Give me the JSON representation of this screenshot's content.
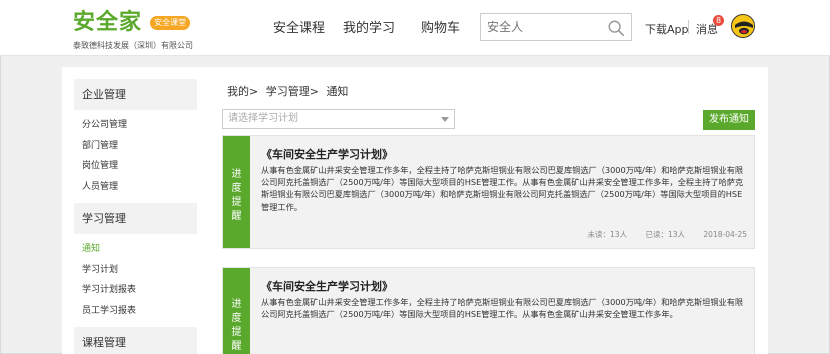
{
  "header": {
    "logo_main": "安全家",
    "logo_badge": "安全课堂",
    "logo_sub": "泰致德科技发展（深圳）有限公司",
    "nav": [
      {
        "label": "安全课程"
      },
      {
        "label": "我的学习"
      },
      {
        "label": "购物车"
      }
    ],
    "search_placeholder": "安全人",
    "download_label": "下载App",
    "message_label": "消息",
    "message_count": "8"
  },
  "sidebar": {
    "groups": [
      {
        "title": "企业管理",
        "items": [
          "分公司管理",
          "部门管理",
          "岗位管理",
          "人员管理"
        ]
      },
      {
        "title": "学习管理",
        "items": [
          "通知",
          "学习计划",
          "学习计划报表",
          "员工学习报表"
        ]
      },
      {
        "title": "课程管理",
        "items": []
      }
    ],
    "active_item": "通知"
  },
  "main": {
    "breadcrumb": [
      "我的>",
      "学习管理>",
      "通知"
    ],
    "select_placeholder": "请选择学习计划",
    "publish_label": "发布通知",
    "cards": [
      {
        "tag": [
          "进",
          "度",
          "提",
          "醒"
        ],
        "title": "《车间安全生产学习计划》",
        "body": "从事有色金属矿山井采安全管理工作多年，全程主持了哈萨克斯坦铜业有限公司巴夏库铜选厂（3000万吨/年）和哈萨克斯坦铜业有限公司阿克托盖铜选厂（2500万吨/年）等国际大型项目的HSE管理工作。从事有色金属矿山井采安全管理工作多年，全程主持了哈萨克斯坦铜业有限公司巴夏库铜选厂（3000万吨/年）和哈萨克斯坦铜业有限公司阿克托盖铜选厂（2500万吨/年）等国际大型项目的HSE管理工作。",
        "unread": "未读：13人",
        "read": "已读：13人",
        "date": "2018-04-25"
      },
      {
        "tag": [
          "进",
          "度",
          "提",
          "醒"
        ],
        "title": "《车间安全生产学习计划》",
        "body": "从事有色金属矿山井采安全管理工作多年，全程主持了哈萨克斯坦铜业有限公司巴夏库铜选厂（3000万吨/年）和哈萨克斯坦铜业有限公司阿克托盖铜选厂（2500万吨/年）等国际大型项目的HSE管理工作。从事有色金属矿山井采安全管理工作多年。",
        "unread": "",
        "read": "",
        "date": ""
      }
    ]
  },
  "colors": {
    "accent": "#5aa92c",
    "badge": "#f5a623",
    "notify": "#e74c3c"
  }
}
